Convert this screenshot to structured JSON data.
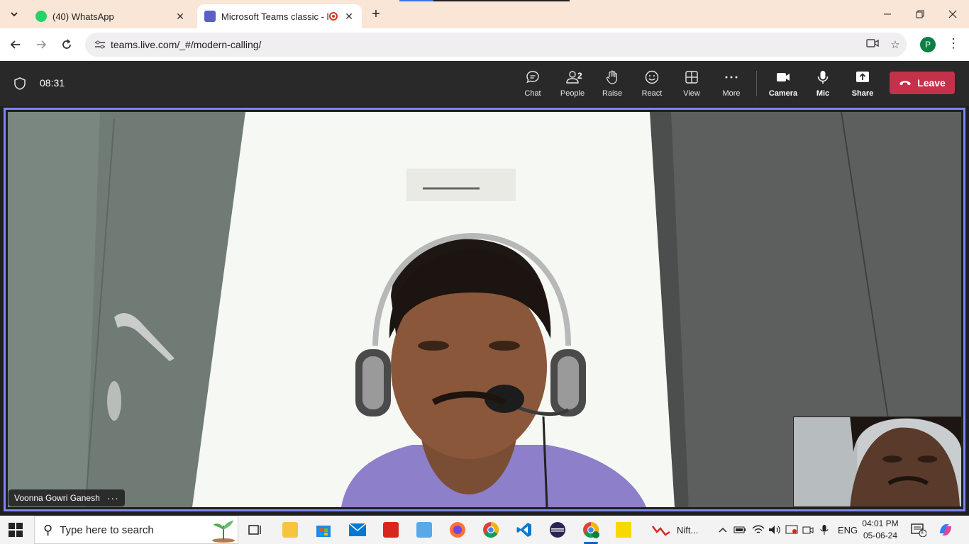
{
  "browser": {
    "tabs": [
      {
        "title": "(40) WhatsApp",
        "icon": "whatsapp-icon",
        "active": false
      },
      {
        "title": "Microsoft Teams classic - lo",
        "icon": "teams-icon",
        "active": true,
        "recording": true
      }
    ],
    "url": "teams.live.com/_#/modern-calling/",
    "profile_initial": "P"
  },
  "meeting": {
    "timer": "08:31",
    "controls": [
      {
        "label": "Chat",
        "icon": "chat-icon"
      },
      {
        "label": "People",
        "icon": "people-icon",
        "count": "2"
      },
      {
        "label": "Raise",
        "icon": "raise-hand-icon"
      },
      {
        "label": "React",
        "icon": "react-icon"
      },
      {
        "label": "View",
        "icon": "view-grid-icon"
      },
      {
        "label": "More",
        "icon": "more-icon"
      },
      {
        "label": "Camera",
        "icon": "camera-icon"
      },
      {
        "label": "Mic",
        "icon": "mic-icon"
      },
      {
        "label": "Share",
        "icon": "share-icon"
      }
    ],
    "leave_label": "Leave",
    "participant_name": "Voonna Gowri Ganesh",
    "accent_color": "#7f85f5",
    "leave_color": "#c4314b"
  },
  "taskbar": {
    "search_placeholder": "Type here to search",
    "apps": [
      "task-view-icon",
      "file-explorer-icon",
      "microsoft-store-icon",
      "mail-icon",
      "acrobat-icon",
      "control-panel-icon",
      "firefox-icon",
      "chrome-icon",
      "vscode-icon",
      "eclipse-icon",
      "chrome-profile-icon",
      "sticky-notes-icon"
    ],
    "nifty_label": "Nift...",
    "language": "ENG",
    "time": "04:01 PM",
    "date": "05-06-24",
    "notification_count": "1"
  }
}
